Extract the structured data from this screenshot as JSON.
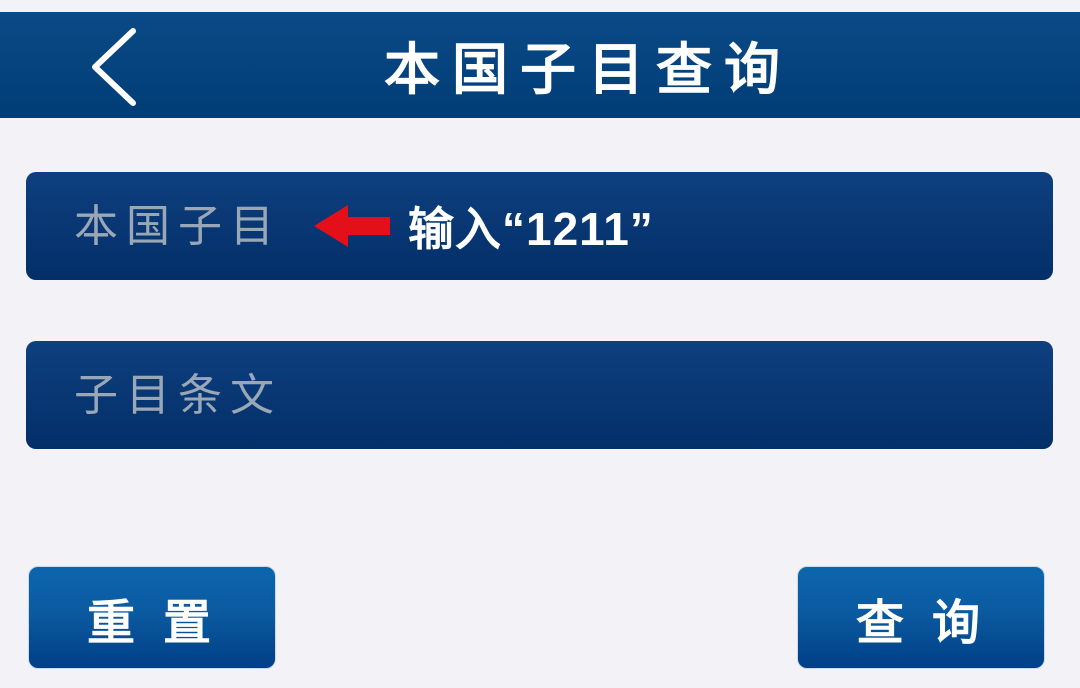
{
  "header": {
    "title": "本国子目查询",
    "back_icon": "chevron-left-icon"
  },
  "fields": [
    {
      "placeholder": "本国子目",
      "value": ""
    },
    {
      "placeholder": "子目条文",
      "value": ""
    }
  ],
  "annotation": {
    "text": "输入“1211”",
    "arrow_icon": "red-arrow-left-icon",
    "arrow_color": "#e3101a"
  },
  "buttons": {
    "reset_label": "重置",
    "query_label": "查询"
  },
  "colors": {
    "header_bg": "#003d77",
    "field_bg": "#0a3a78",
    "button_bg": "#0b5aa0",
    "page_bg": "#f3f2f6"
  }
}
